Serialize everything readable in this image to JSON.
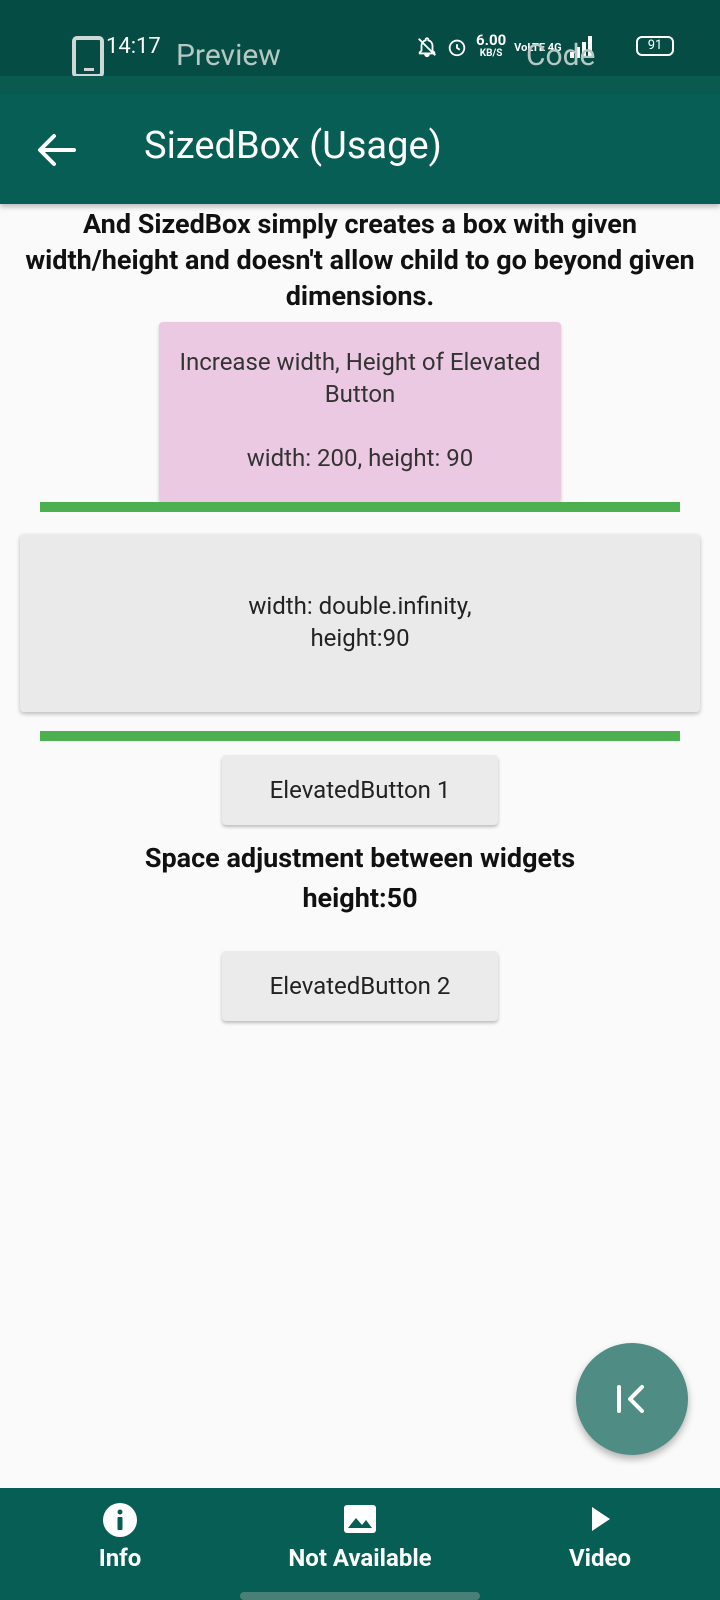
{
  "status_bar": {
    "time": "14:17",
    "tab_left": "Preview",
    "tab_right": "Code",
    "speed_value": "6.00",
    "speed_unit": "KB/S",
    "network_label": "VoLTE 4G",
    "battery": "91",
    "icons": [
      "phone-icon",
      "mute-icon",
      "alarm-icon",
      "signal-icon",
      "battery-icon"
    ]
  },
  "app_bar": {
    "title": "SizedBox (Usage)",
    "back_icon": "arrow-back-icon"
  },
  "content": {
    "intro": "And SizedBox simply creates a box with given width/height and doesn't allow child to go beyond given dimensions.",
    "box_200": {
      "line1": "Increase width, Height of Elevated Button",
      "line2": "width: 200, height: 90"
    },
    "box_infinity": {
      "line1": "width: double.infinity,",
      "line2": "height:90"
    },
    "button1": "ElevatedButton 1",
    "space_label_line1": "Space adjustment between widgets",
    "space_label_line2": "height:50",
    "button2": "ElevatedButton 2"
  },
  "fab": {
    "icon": "first-page-icon"
  },
  "bottom_nav": {
    "items": [
      {
        "label": "Info",
        "icon": "info-icon"
      },
      {
        "label": "Not Available",
        "icon": "image-icon"
      },
      {
        "label": "Video",
        "icon": "play-icon"
      }
    ]
  },
  "colors": {
    "primary": "#075e54",
    "status_bar": "#054d44",
    "accent_green": "#4caf50",
    "pink_box": "#ecc9e3",
    "fab": "#4f8c84"
  }
}
